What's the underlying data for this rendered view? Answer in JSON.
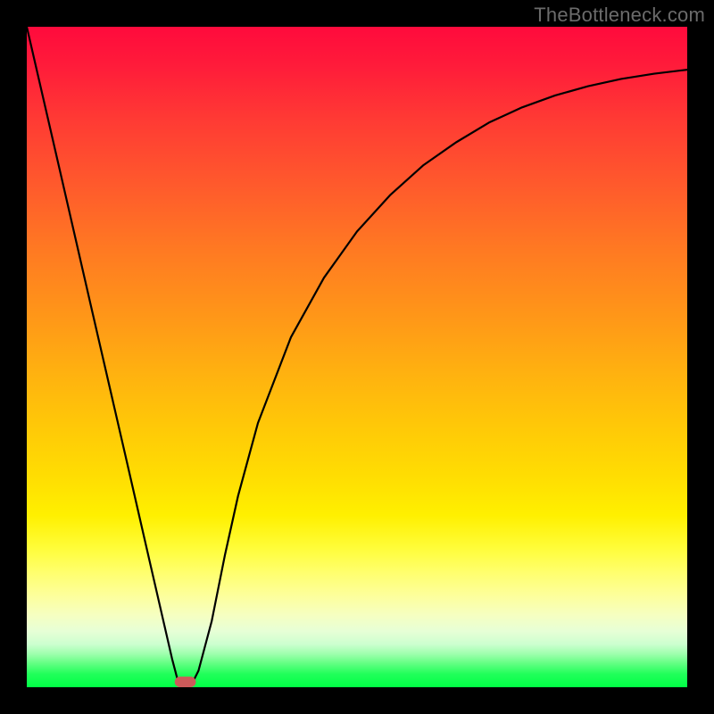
{
  "watermark": {
    "text": "TheBottleneck.com"
  },
  "chart_data": {
    "type": "line",
    "title": "",
    "xlabel": "",
    "ylabel": "",
    "xlim": [
      0,
      100
    ],
    "ylim": [
      0,
      100
    ],
    "grid": false,
    "series": [
      {
        "name": "curve",
        "x": [
          0,
          5,
          10,
          15,
          18,
          20,
          22,
          23,
          24,
          25,
          26,
          28,
          30,
          32,
          35,
          40,
          45,
          50,
          55,
          60,
          65,
          70,
          75,
          80,
          85,
          90,
          95,
          100
        ],
        "y": [
          100,
          78.3,
          56.5,
          34.8,
          21.7,
          13.0,
          4.3,
          0.5,
          0,
          0.5,
          2.5,
          10.0,
          20.0,
          29.0,
          40.0,
          53.0,
          62.0,
          69.0,
          74.5,
          79.0,
          82.5,
          85.5,
          87.8,
          89.6,
          91.0,
          92.1,
          92.9,
          93.5
        ]
      }
    ],
    "marker": {
      "name": "vertex-marker",
      "x_center": 24,
      "y": 0,
      "width_x": 3.2,
      "height_y": 1.6,
      "fill": "#cc5a5a"
    },
    "background_gradient": {
      "stops": [
        {
          "pos": 0.0,
          "color": "#ff0a3c"
        },
        {
          "pos": 0.5,
          "color": "#ffb010"
        },
        {
          "pos": 0.8,
          "color": "#ffff6c"
        },
        {
          "pos": 0.95,
          "color": "#9dffac"
        },
        {
          "pos": 1.0,
          "color": "#00ff46"
        }
      ]
    }
  }
}
